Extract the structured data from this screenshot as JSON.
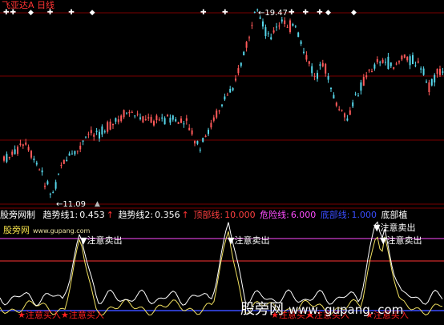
{
  "top_title": {
    "name": "飞亚达A",
    "period": "日线"
  },
  "price_labels": {
    "high": "19.47",
    "low": "11.09"
  },
  "markers": {
    "diamond": "◆",
    "star": "✚"
  },
  "indicator_header": {
    "name": "股旁网制",
    "trend1_label": "趋势线1:",
    "trend1_value": "0.453",
    "trend2_label": "趋势线2:",
    "trend2_value": "0.356",
    "top_label": "顶部线:",
    "top_value": "10.000",
    "danger_label": "危险线:",
    "danger_value": "6.000",
    "bottom_label": "底部线:",
    "bottom_value": "1.000",
    "bottom_buy_label": "底部植"
  },
  "site": {
    "name": "股旁网",
    "url": "www.gupang.com"
  },
  "signals": {
    "sell": "注意卖出",
    "buy": "注意买入"
  },
  "watermark": {
    "name": "股旁网",
    "url": "www. gupang. com"
  },
  "colors": {
    "up": "#ff5a5a",
    "down": "#56d6ea",
    "title": "#ff3333",
    "trend1": "#ffffff",
    "trend2": "#f0e060",
    "top_line": "#ff4dff",
    "danger_line": "#ff3333",
    "bottom_line": "#3a4dff",
    "sell_marker": "#ffffff",
    "buy_marker": "#ff2020"
  }
}
